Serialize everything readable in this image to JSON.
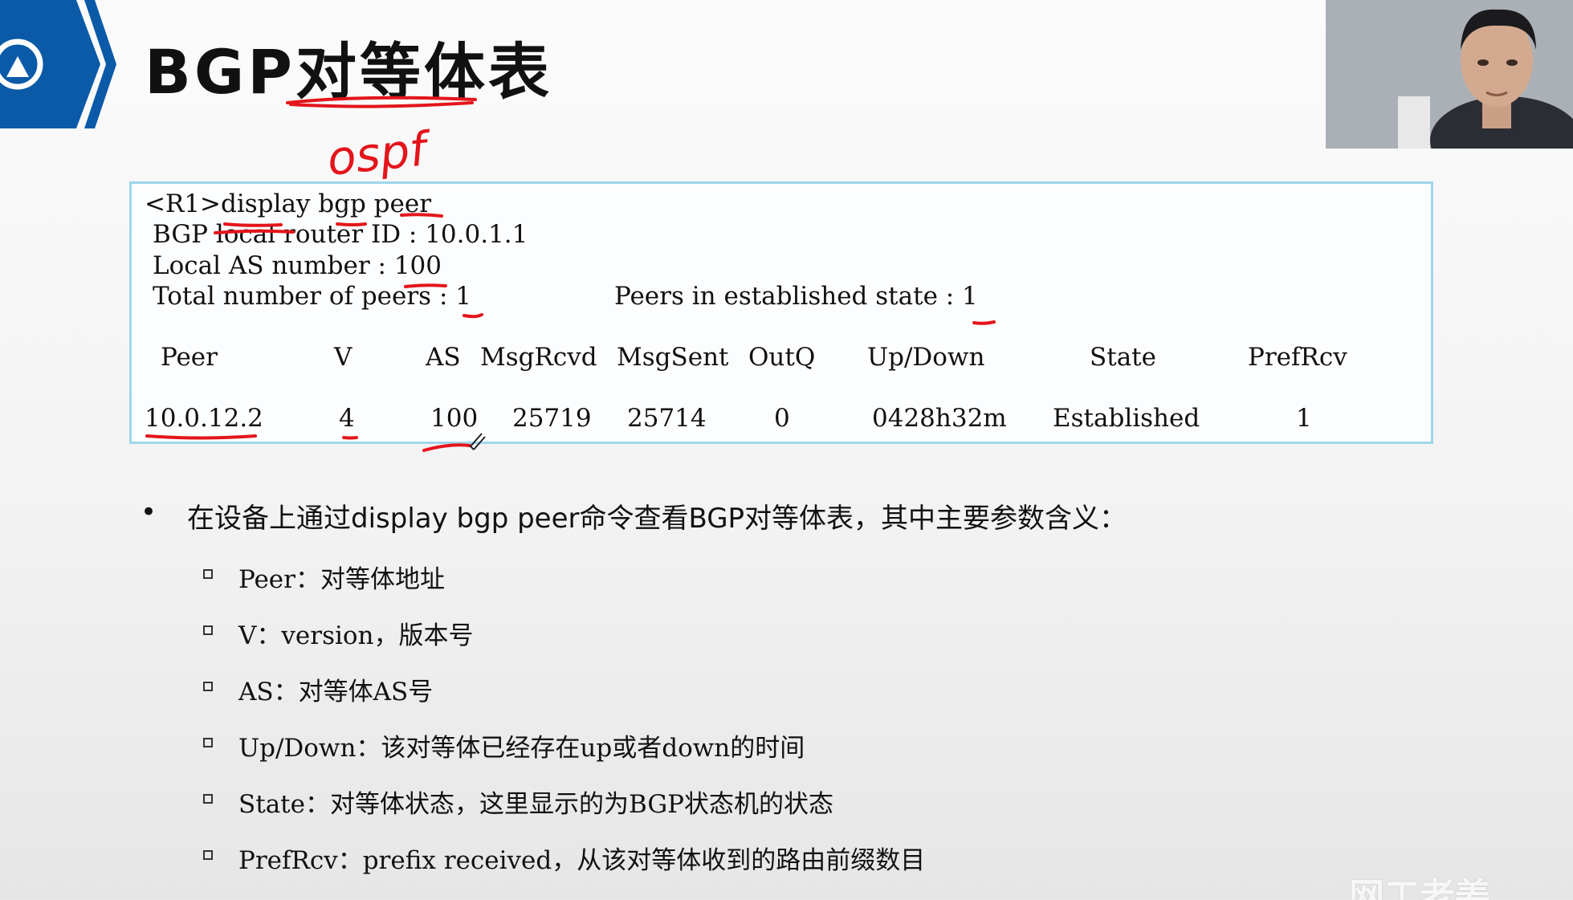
{
  "slide": {
    "title": "BGP对等体表",
    "handwritten_note": "ospf"
  },
  "cli": {
    "command": "<R1>display bgp peer",
    "router_id_line": "BGP local router ID : 10.0.1.1",
    "local_as_line": "Local AS number : 100",
    "total_peers_line": "Total number of peers : 1",
    "established_line": "Peers in established state : 1",
    "headers": [
      "Peer",
      "V",
      "AS",
      "MsgRcvd",
      "MsgSent",
      "OutQ",
      "Up/Down",
      "State",
      "PrefRcv"
    ],
    "row": [
      "10.0.12.2",
      "4",
      "100",
      "25719",
      "25714",
      "0",
      "0428h32m",
      "Established",
      "1"
    ]
  },
  "bullets": {
    "main_marker": "•",
    "main_text": "在设备上通过display bgp peer命令查看BGP对等体表，其中主要参数含义：",
    "items": [
      "Peer：对等体地址",
      "V：version，版本号",
      "AS：对等体AS号",
      "Up/Down：该对等体已经存在up或者down的时间",
      "State：对等体状态，这里显示的为BGP状态机的状态",
      "PrefRcv：prefix received，从该对等体收到的路由前缀数目"
    ]
  },
  "watermark": "网工老姜",
  "colors": {
    "logo_blue": "#0a5aa8",
    "box_border": "#9fd6ea",
    "annotation_red": "#e3151b"
  }
}
